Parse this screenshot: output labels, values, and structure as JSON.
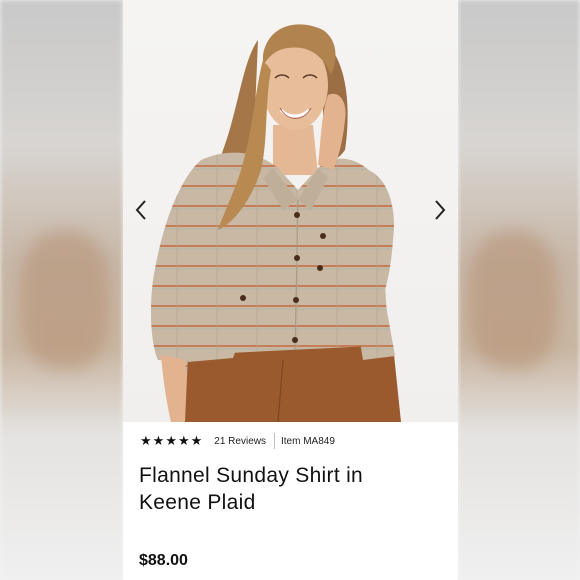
{
  "gallery": {
    "prev_icon": "chevron-left-icon",
    "next_icon": "chevron-right-icon"
  },
  "product": {
    "rating_stars": 5,
    "reviews_label": "21 Reviews",
    "item_label": "Item MA849",
    "title_line1": "Flannel Sunday Shirt in",
    "title_line2": "Keene Plaid",
    "price": "$88.00"
  },
  "colors": {
    "shirt": "#c7b7a2",
    "stripe": "#c4693f",
    "pants": "#9a5a2e",
    "text": "#111111"
  }
}
